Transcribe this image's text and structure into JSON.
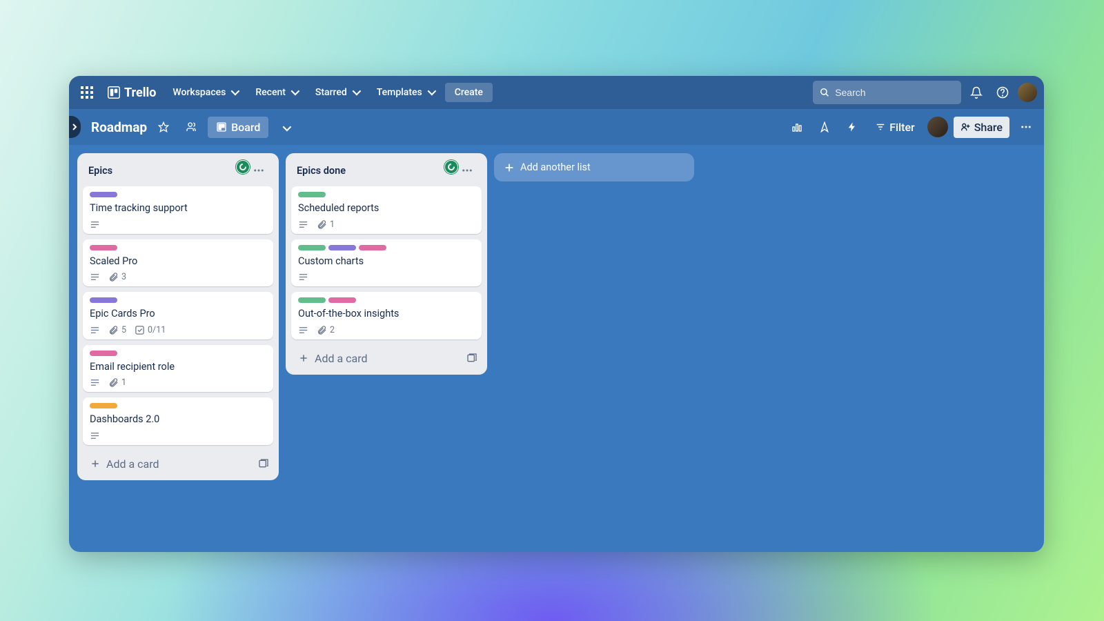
{
  "app": {
    "name": "Trello"
  },
  "topnav": {
    "items": [
      "Workspaces",
      "Recent",
      "Starred",
      "Templates"
    ],
    "create": "Create",
    "search_placeholder": "Search"
  },
  "board": {
    "name": "Roadmap",
    "view_label": "Board",
    "filter_label": "Filter",
    "share_label": "Share"
  },
  "lists": [
    {
      "title": "Epics",
      "cards": [
        {
          "labels": [
            "purple"
          ],
          "title": "Time tracking support",
          "badges": {
            "desc": true
          }
        },
        {
          "labels": [
            "pink"
          ],
          "title": "Scaled Pro",
          "badges": {
            "desc": true,
            "attachments": 3
          }
        },
        {
          "labels": [
            "purple"
          ],
          "title": "Epic Cards Pro",
          "badges": {
            "desc": true,
            "attachments": 5,
            "checklist": "0/11"
          }
        },
        {
          "labels": [
            "pink"
          ],
          "title": "Email recipient role",
          "badges": {
            "desc": true,
            "attachments": 1
          }
        },
        {
          "labels": [
            "orange"
          ],
          "title": "Dashboards 2.0",
          "badges": {
            "desc": true
          }
        }
      ],
      "add_card": "Add a card"
    },
    {
      "title": "Epics done",
      "cards": [
        {
          "labels": [
            "green"
          ],
          "title": "Scheduled reports",
          "badges": {
            "desc": true,
            "attachments": 1
          }
        },
        {
          "labels": [
            "green",
            "purple",
            "pink"
          ],
          "title": "Custom charts",
          "badges": {
            "desc": true
          }
        },
        {
          "labels": [
            "green",
            "pink"
          ],
          "title": "Out-of-the-box insights",
          "badges": {
            "desc": true,
            "attachments": 2
          }
        }
      ],
      "add_card": "Add a card"
    }
  ],
  "add_list": "Add another list"
}
